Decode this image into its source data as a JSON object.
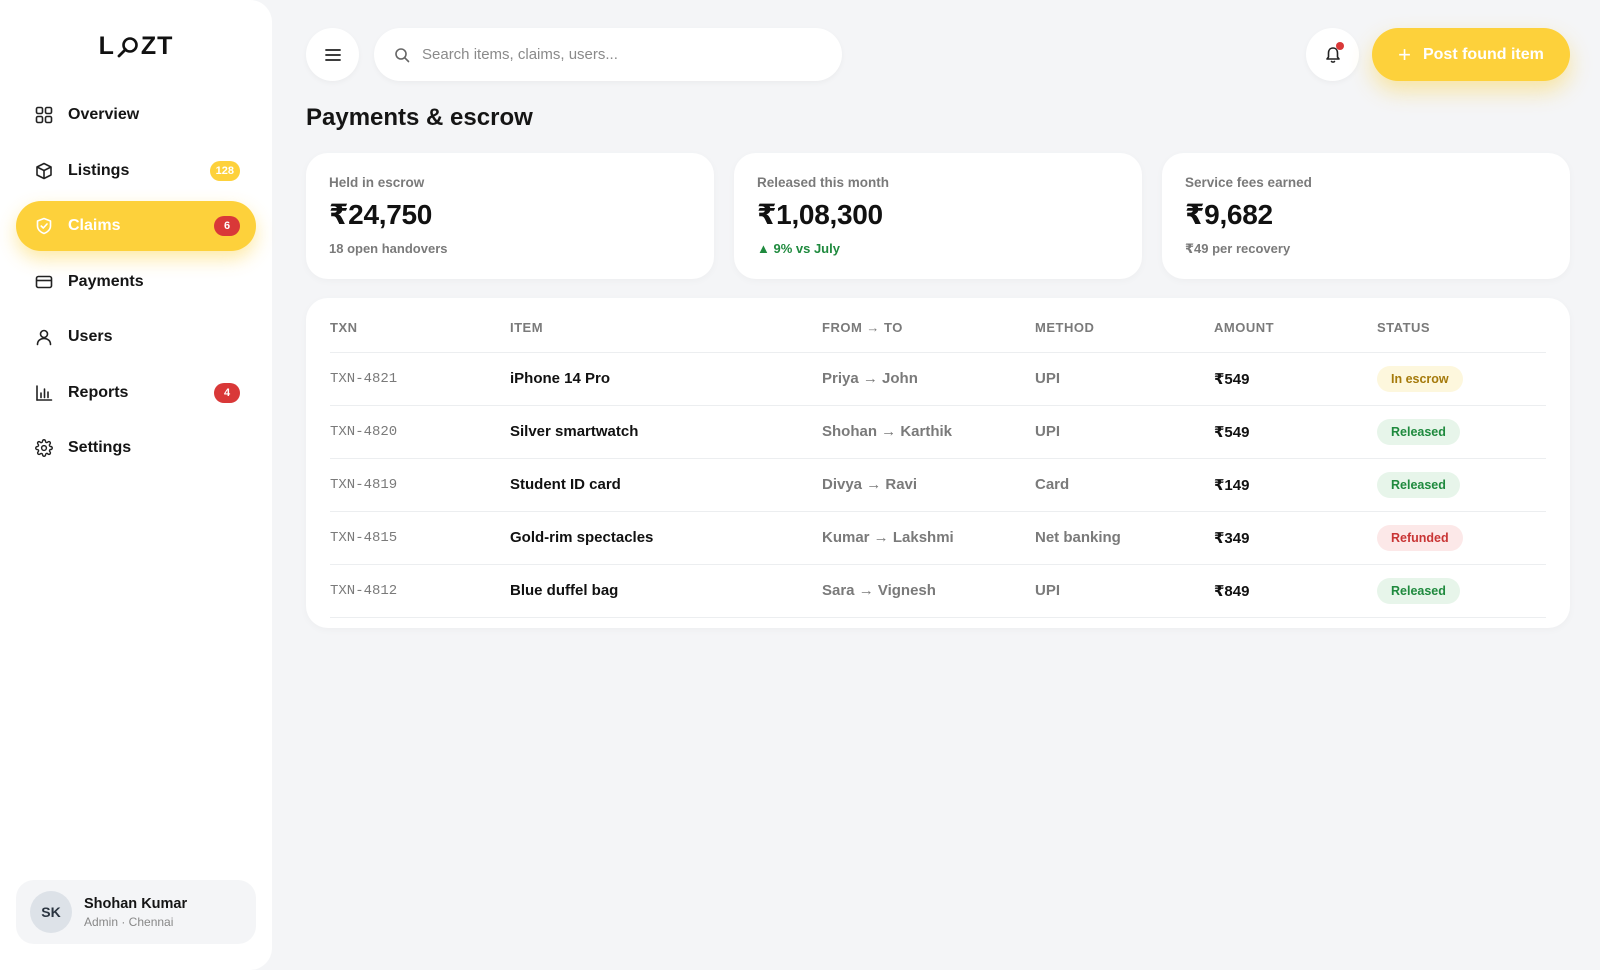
{
  "brand": {
    "left": "L",
    "right": "ZT"
  },
  "nav": [
    {
      "label": "Overview",
      "icon": "grid-icon",
      "badge": ""
    },
    {
      "label": "Listings",
      "icon": "box-icon",
      "badge": "128"
    },
    {
      "label": "Claims",
      "icon": "shield-icon",
      "badge": "6"
    },
    {
      "label": "Payments",
      "icon": "card-icon",
      "badge": ""
    },
    {
      "label": "Users",
      "icon": "user-icon",
      "badge": ""
    },
    {
      "label": "Reports",
      "icon": "bar-chart-icon",
      "badge": "4"
    },
    {
      "label": "Settings",
      "icon": "gear-icon",
      "badge": ""
    }
  ],
  "active_nav": "Claims",
  "user": {
    "initials": "SK",
    "name": "Shohan Kumar",
    "role": "Admin · Chennai"
  },
  "search": {
    "placeholder": "Search items, claims, users..."
  },
  "actions": {
    "post_label": "Post found item"
  },
  "page": {
    "title": "Payments & escrow"
  },
  "stats": [
    {
      "label": "Held in escrow",
      "value": "₹24,750",
      "sub": "18 open handovers"
    },
    {
      "label": "Released this month",
      "value": "₹1,08,300",
      "sub": "▲ 9% vs July"
    },
    {
      "label": "Service fees earned",
      "value": "₹9,682",
      "sub": "₹49 per recovery"
    }
  ],
  "table": {
    "headers": [
      "TXN",
      "ITEM",
      "FROM → TO",
      "METHOD",
      "AMOUNT",
      "STATUS"
    ],
    "rows": [
      {
        "txn": "TXN-4821",
        "item": "iPhone 14 Pro",
        "from_to": "Priya → John",
        "method": "UPI",
        "amount": "₹549",
        "status": "In escrow"
      },
      {
        "txn": "TXN-4820",
        "item": "Silver smartwatch",
        "from_to": "Shohan → Karthik",
        "method": "UPI",
        "amount": "₹549",
        "status": "Released"
      },
      {
        "txn": "TXN-4819",
        "item": "Student ID card",
        "from_to": "Divya → Ravi",
        "method": "Card",
        "amount": "₹149",
        "status": "Released"
      },
      {
        "txn": "TXN-4815",
        "item": "Gold-rim spectacles",
        "from_to": "Kumar → Lakshmi",
        "method": "Net banking",
        "amount": "₹349",
        "status": "Refunded"
      },
      {
        "txn": "TXN-4812",
        "item": "Blue duffel bag",
        "from_to": "Sara → Vignesh",
        "method": "UPI",
        "amount": "₹849",
        "status": "Released"
      }
    ]
  },
  "colors": {
    "accent": "#fdd13b",
    "badge_red": "#d93838",
    "success": "#1f8a3e",
    "danger": "#c93535",
    "warning": "#a57a0b"
  }
}
